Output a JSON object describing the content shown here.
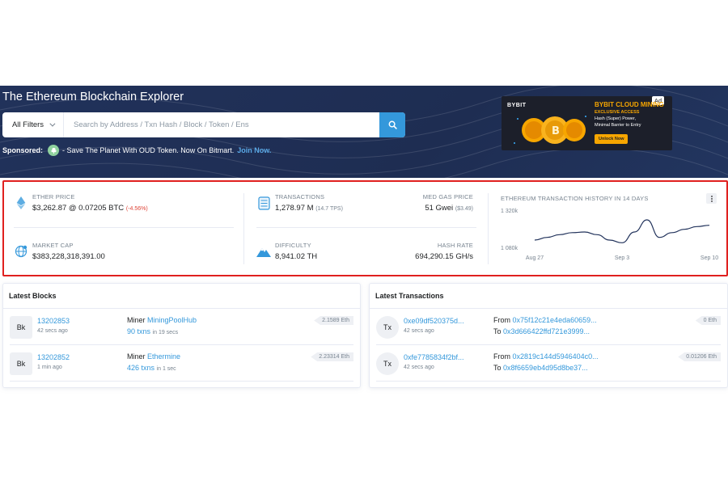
{
  "hero": {
    "title": "The Ethereum Blockchain Explorer",
    "filter_label": "All Filters",
    "search_placeholder": "Search by Address / Txn Hash / Block / Token / Ens",
    "sponsored_label": "Sponsored:",
    "sponsored_text": "- Save The Planet With OUD Token. Now On Bitmart.",
    "sponsored_link": "Join Now."
  },
  "ad": {
    "tag": "Ad",
    "brand": "BYBIT",
    "title": "BYBIT CLOUD MINING",
    "subtitle": "EXCLUSIVE ACCESS",
    "line1": "Hash (Super) Power,",
    "line2": "Minimal Barrier to Entry",
    "button": "Unlock Now"
  },
  "stats": {
    "ether_price": {
      "label": "ETHER PRICE",
      "value": "$3,262.87 @ 0.07205 BTC",
      "change": "(-4.56%)"
    },
    "market_cap": {
      "label": "MARKET CAP",
      "value": "$383,228,318,391.00"
    },
    "transactions": {
      "label": "TRANSACTIONS",
      "value": "1,278.97 M",
      "tps": "(14.7 TPS)"
    },
    "gas": {
      "label": "MED GAS PRICE",
      "value": "51 Gwei",
      "usd": "($3.49)"
    },
    "difficulty": {
      "label": "DIFFICULTY",
      "value": "8,941.02 TH"
    },
    "hash_rate": {
      "label": "HASH RATE",
      "value": "694,290.15 GH/s"
    }
  },
  "chart_title": "ETHEREUM TRANSACTION HISTORY IN 14 DAYS",
  "chart_data": {
    "type": "line",
    "title": "ETHEREUM TRANSACTION HISTORY IN 14 DAYS",
    "y_tick_labels": [
      "1 320k",
      "1 080k"
    ],
    "x_tick_labels": [
      "Aug 27",
      "Sep 3",
      "Sep 10"
    ],
    "ylim": [
      1080000,
      1320000
    ],
    "x": [
      "Aug 27",
      "Aug 28",
      "Aug 29",
      "Aug 30",
      "Aug 31",
      "Sep 1",
      "Sep 2",
      "Sep 3",
      "Sep 4",
      "Sep 5",
      "Sep 6",
      "Sep 7",
      "Sep 8",
      "Sep 9",
      "Sep 10"
    ],
    "values": [
      1140000,
      1160000,
      1180000,
      1195000,
      1200000,
      1180000,
      1140000,
      1120000,
      1200000,
      1290000,
      1160000,
      1195000,
      1220000,
      1240000,
      1250000
    ],
    "grid": false,
    "legend": "none"
  },
  "latest_blocks": {
    "title": "Latest Blocks",
    "rows": [
      {
        "badge": "Bk",
        "block": "13202853",
        "time": "42 secs ago",
        "miner_label": "Miner",
        "miner": "MiningPoolHub",
        "txns": "90 txns",
        "duration": "in 19 secs",
        "reward": "2.1589 Eth"
      },
      {
        "badge": "Bk",
        "block": "13202852",
        "time": "1 min ago",
        "miner_label": "Miner",
        "miner": "Ethermine",
        "txns": "426 txns",
        "duration": "in 1 sec",
        "reward": "2.23314 Eth"
      }
    ]
  },
  "latest_transactions": {
    "title": "Latest Transactions",
    "rows": [
      {
        "badge": "Tx",
        "hash": "0xe09df520375d...",
        "time": "42 secs ago",
        "from_label": "From",
        "from": "0x75f12c21e4eda60659...",
        "to_label": "To",
        "to": "0x3d666422ffd721e3999...",
        "amount": "0 Eth"
      },
      {
        "badge": "Tx",
        "hash": "0xfe7785834f2bf...",
        "time": "42 secs ago",
        "from_label": "From",
        "from": "0x2819c144d5946404c0...",
        "to_label": "To",
        "to": "0x8f6659eb4d95d8be37...",
        "amount": "0.01206 Eth"
      }
    ]
  },
  "colors": {
    "hero": "#21325b",
    "accent": "#3498db",
    "highlight": "#e0201f",
    "negative": "#de4437"
  }
}
